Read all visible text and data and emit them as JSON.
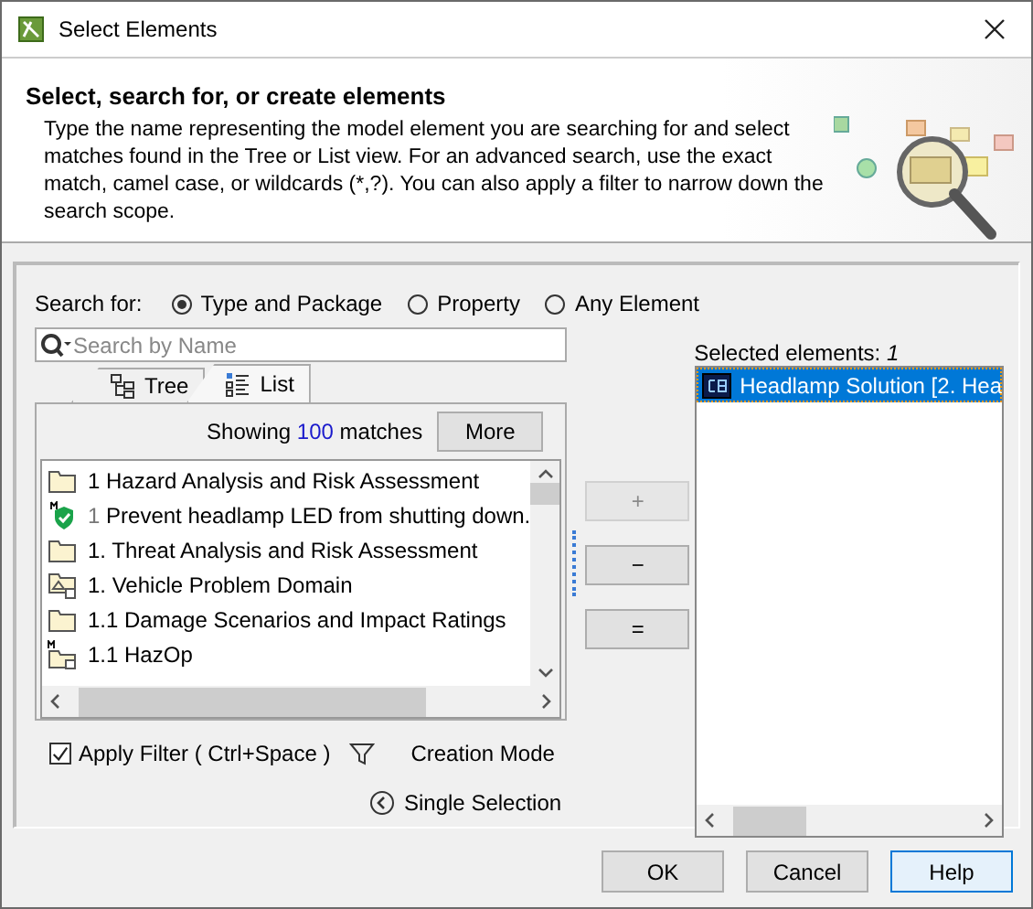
{
  "window": {
    "title": "Select Elements"
  },
  "header": {
    "title": "Select, search for, or create elements",
    "description": "Type the name representing the model element you are searching for and select matches found in the Tree or List view. For an advanced search, use the exact match, camel case, or wildcards (*,?). You can also apply a filter to narrow down the search scope."
  },
  "search_for": {
    "label": "Search for:",
    "options": [
      {
        "label": "Type and Package",
        "selected": true
      },
      {
        "label": "Property",
        "selected": false
      },
      {
        "label": "Any Element",
        "selected": false
      }
    ]
  },
  "search": {
    "placeholder": "Search by Name"
  },
  "tabs": [
    {
      "label": "Tree",
      "kind": "tree",
      "selected": false
    },
    {
      "label": "List",
      "kind": "list",
      "selected": true
    }
  ],
  "matches": {
    "prefix": "Showing",
    "count": "100",
    "suffix": "matches",
    "button": "More"
  },
  "results": [
    {
      "kind": "folder",
      "label": "1 Hazard Analysis and Risk Assessment"
    },
    {
      "kind": "requirement",
      "number": "1",
      "label": "Prevent headlamp LED from shutting down."
    },
    {
      "kind": "folder",
      "label": "1. Threat Analysis and Risk Assessment"
    },
    {
      "kind": "domain",
      "label": "1. Vehicle Problem Domain"
    },
    {
      "kind": "folder",
      "label": "1.1 Damage Scenarios and Impact Ratings"
    },
    {
      "kind": "model",
      "label": "1.1 HazOp"
    }
  ],
  "move_buttons": [
    {
      "label": "+",
      "disabled": true
    },
    {
      "label": "−",
      "disabled": false
    },
    {
      "label": "=",
      "disabled": false
    }
  ],
  "apply_filter": {
    "label": "Apply Filter ( Ctrl+Space )",
    "checked": true
  },
  "creation_mode": "Creation Mode",
  "single_selection": "Single Selection",
  "selected": {
    "label": "Selected elements: *1*",
    "items": [
      {
        "label": "Headlamp Solution [2. Hea",
        "selected": true
      }
    ]
  },
  "buttons": [
    {
      "label": "OK",
      "focused": false
    },
    {
      "label": "Cancel",
      "focused": false
    },
    {
      "label": "Help",
      "focused": true
    }
  ]
}
